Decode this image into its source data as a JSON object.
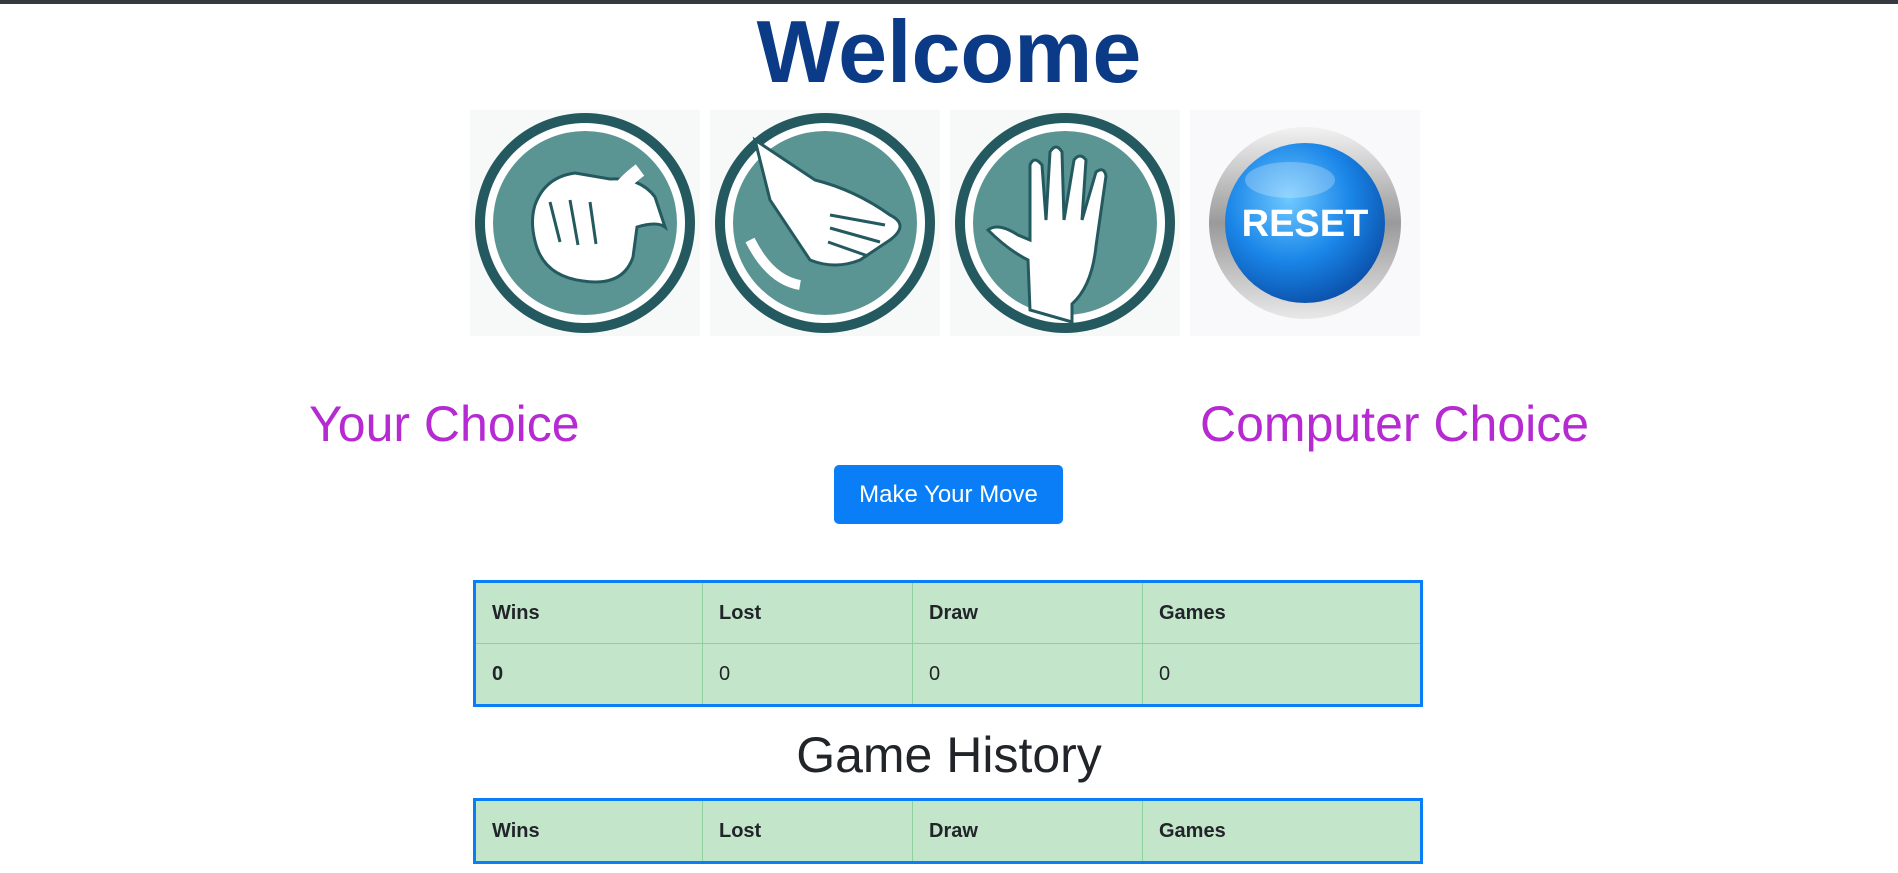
{
  "page": {
    "title": "Welcome"
  },
  "moves": [
    {
      "name": "rock",
      "icon": "rock-fist-icon"
    },
    {
      "name": "paper",
      "icon": "paper-hand-icon"
    },
    {
      "name": "spock",
      "icon": "spock-hand-icon"
    },
    {
      "name": "reset",
      "icon": "reset-button-icon",
      "label": "RESET"
    }
  ],
  "choices": {
    "yours": "Your Choice",
    "computer": "Computer Choice"
  },
  "actions": {
    "make_move": "Make Your Move"
  },
  "scoreboard": {
    "headers": [
      "Wins",
      "Lost",
      "Draw",
      "Games"
    ],
    "values": [
      "0",
      "0",
      "0",
      "0"
    ]
  },
  "history": {
    "title": "Game History",
    "headers": [
      "Wins",
      "Lost",
      "Draw",
      "Games"
    ]
  },
  "colors": {
    "title": "#0b3a86",
    "accent": "#b52bd1",
    "button": "#097ef7",
    "table_bg": "#c3e6cb",
    "icon_teal": "#5b9593",
    "icon_dark": "#245a5f"
  }
}
